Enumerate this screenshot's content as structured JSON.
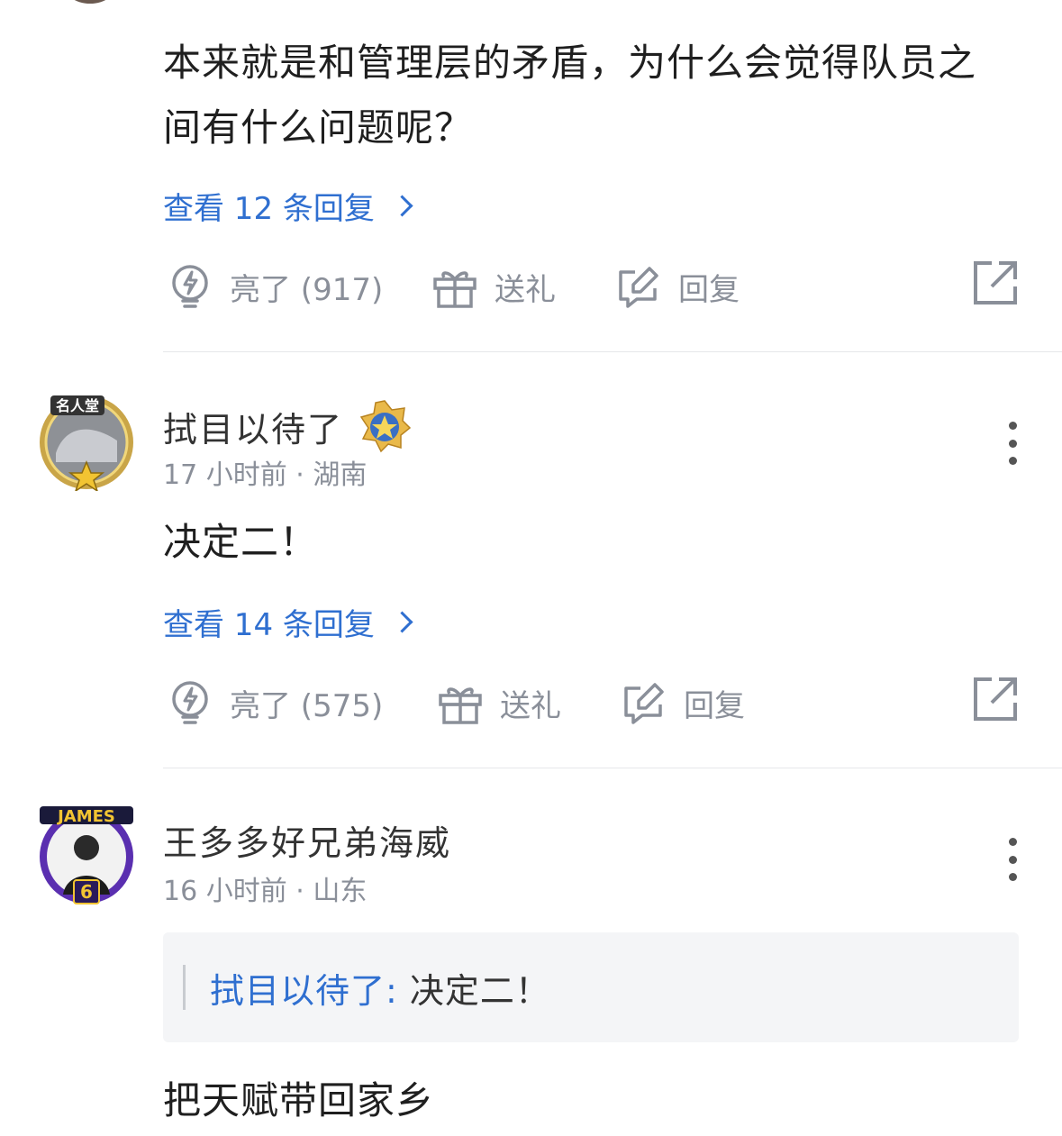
{
  "comment1": {
    "content": "本来就是和管理层的矛盾，为什么会觉得队员之间有什么问题呢？",
    "view_replies": "查看 12 条回复",
    "actions": {
      "like": "亮了 (917)",
      "gift": "送礼",
      "reply": "回复"
    }
  },
  "comment2": {
    "name": "拭目以待了",
    "avatar_text": "名人堂",
    "meta": "17 小时前 · 湖南",
    "content": "决定二！",
    "view_replies": "查看 14 条回复",
    "actions": {
      "like": "亮了 (575)",
      "gift": "送礼",
      "reply": "回复"
    }
  },
  "comment3": {
    "name": "王多多好兄弟海威",
    "avatar_text": "JAMES",
    "avatar_badge": "6",
    "meta": "16 小时前 · 山东",
    "quote_name": "拭目以待了:",
    "quote_body": " 决定二！",
    "content": "把天赋带回家乡"
  },
  "colors": {
    "link": "#2f6fd0",
    "muted": "#8a8f99",
    "quote_bg": "#f4f5f7"
  }
}
